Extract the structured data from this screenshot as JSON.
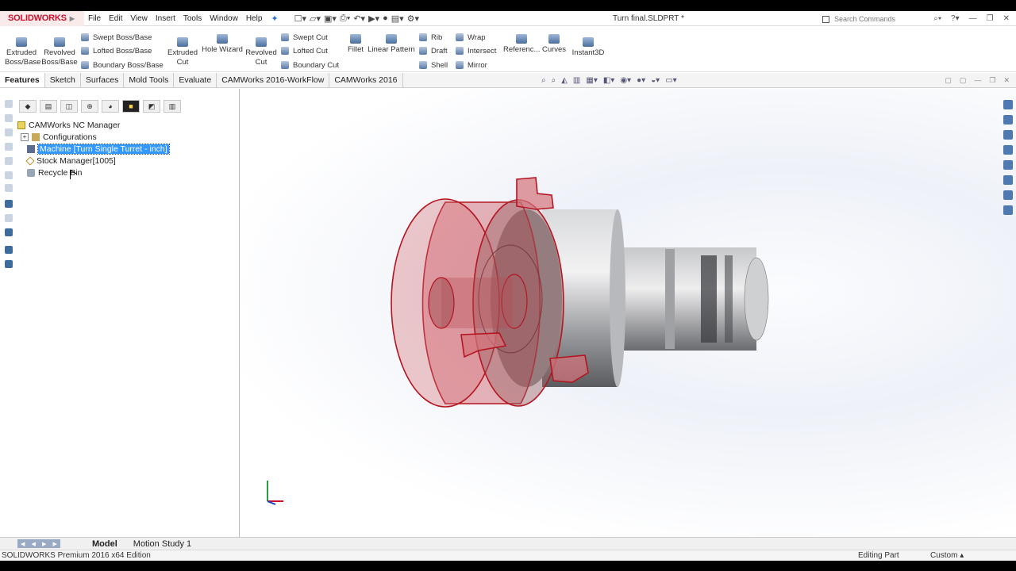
{
  "app": {
    "logo": "SOLIDWORKS",
    "doc_title": "Turn final.SLDPRT *"
  },
  "menu": [
    "File",
    "Edit",
    "View",
    "Insert",
    "Tools",
    "Window",
    "Help"
  ],
  "search": {
    "placeholder": "Search Commands"
  },
  "ribbon": {
    "extruded_boss": [
      "Extruded",
      "Boss/Base"
    ],
    "revolved_boss": [
      "Revolved",
      "Boss/Base"
    ],
    "swept_boss": "Swept Boss/Base",
    "lofted_boss": "Lofted Boss/Base",
    "boundary_boss": "Boundary Boss/Base",
    "extruded_cut": [
      "Extruded",
      "Cut"
    ],
    "hole_wizard": "Hole Wizard",
    "revolved_cut": [
      "Revolved",
      "Cut"
    ],
    "swept_cut": "Swept Cut",
    "lofted_cut": "Lofted Cut",
    "boundary_cut": "Boundary Cut",
    "fillet": "Fillet",
    "linear_pattern": "Linear Pattern",
    "rib": "Rib",
    "draft": "Draft",
    "shell": "Shell",
    "wrap": "Wrap",
    "intersect": "Intersect",
    "mirror": "Mirror",
    "reference": "Referenc...",
    "curves": "Curves",
    "instant3d": "Instant3D"
  },
  "tabs": [
    "Features",
    "Sketch",
    "Surfaces",
    "Mold Tools",
    "Evaluate",
    "CAMWorks 2016-WorkFlow",
    "CAMWorks 2016"
  ],
  "tree": {
    "root": "CAMWorks NC Manager",
    "items": [
      "Configurations",
      "Machine [Turn Single Turret - inch]",
      "Stock Manager[1005]",
      "Recycle Bin"
    ]
  },
  "bottom_tabs": [
    "Model",
    "Motion Study 1"
  ],
  "status": {
    "left": "SOLIDWORKS Premium 2016 x64 Edition",
    "mode": "Editing Part",
    "units": "Custom"
  },
  "colors": {
    "logo_red": "#c8102e",
    "selection_blue": "#3399ff",
    "stock_red": "#c0202a"
  }
}
